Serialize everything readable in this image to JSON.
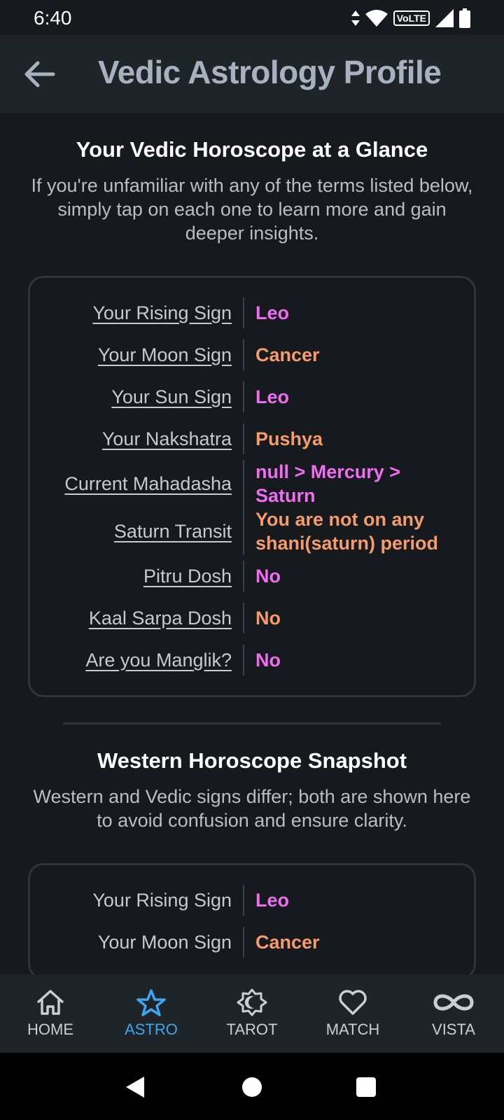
{
  "status_bar": {
    "time": "6:40",
    "volte": "VoLTE"
  },
  "header": {
    "title": "Vedic Astrology Profile"
  },
  "vedic": {
    "title": "Your Vedic Horoscope at a Glance",
    "subtitle": "If you're unfamiliar with any of the terms listed below, simply tap on each one to learn more and gain deeper insights.",
    "rows": [
      {
        "label": "Your Rising Sign",
        "value": "Leo",
        "color": "pink"
      },
      {
        "label": "Your Moon Sign",
        "value": "Cancer",
        "color": "orange"
      },
      {
        "label": "Your Sun Sign",
        "value": "Leo",
        "color": "pink"
      },
      {
        "label": "Your Nakshatra",
        "value": "Pushya",
        "color": "orange"
      },
      {
        "label": "Current Mahadasha",
        "value": "null > Mercury > Saturn",
        "color": "pink"
      },
      {
        "label": "Saturn Transit",
        "value": "You are not on any shani(saturn) period",
        "color": "orange"
      },
      {
        "label": "Pitru Dosh",
        "value": "No",
        "color": "pink"
      },
      {
        "label": "Kaal Sarpa Dosh",
        "value": "No",
        "color": "orange"
      },
      {
        "label": "Are you Manglik?",
        "value": "No",
        "color": "pink"
      }
    ]
  },
  "western": {
    "title": "Western Horoscope Snapshot",
    "subtitle": "Western and Vedic signs differ; both are shown here to avoid confusion and ensure clarity.",
    "rows": [
      {
        "label": "Your Rising Sign",
        "value": "Leo",
        "color": "pink"
      },
      {
        "label": "Your Moon Sign",
        "value": "Cancer",
        "color": "orange"
      }
    ]
  },
  "bottom_nav": {
    "home": "HOME",
    "astro": "ASTRO",
    "tarot": "TAROT",
    "match": "MATCH",
    "vista": "VISTA",
    "active": "astro"
  },
  "colors": {
    "pink": "#f06cf0",
    "orange": "#f59b6c",
    "accent": "#3ea6ee"
  }
}
